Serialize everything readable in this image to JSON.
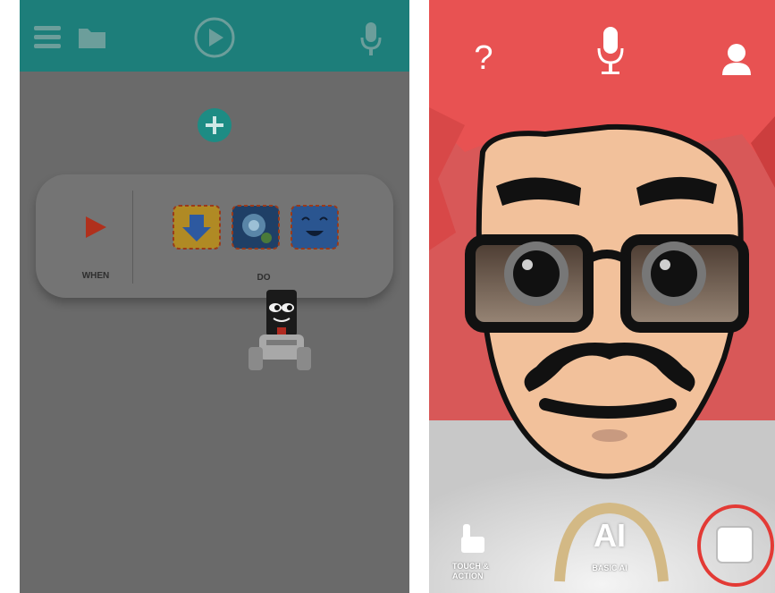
{
  "left_screen": {
    "rule_card": {
      "when_label": "WHEN",
      "do_label": "DO"
    },
    "icons": [
      "menu-icon",
      "folder-icon",
      "play-circle-icon",
      "microphone-icon",
      "add-icon",
      "play-triangle-icon",
      "robot-mascot-icon"
    ],
    "colors": {
      "toolbar": "#1d7e7a",
      "background": "#6a6a6a",
      "add_button": "#1d8c84",
      "play_arrow": "#b0301c"
    }
  },
  "right_screen": {
    "help_label": "?",
    "modes": {
      "touch_action_label_line1": "TOUCH &",
      "touch_action_label_line2": "ACTION",
      "ai_big_label": "AI",
      "basic_ai_label": "BASIC AI"
    },
    "icons": [
      "help-icon",
      "microphone-icon",
      "profile-icon",
      "touch-hand-icon",
      "stop-icon"
    ],
    "colors": {
      "hair": "#e85252",
      "skin": "#f2c19b",
      "highlight_circle": "#e33a35"
    }
  }
}
